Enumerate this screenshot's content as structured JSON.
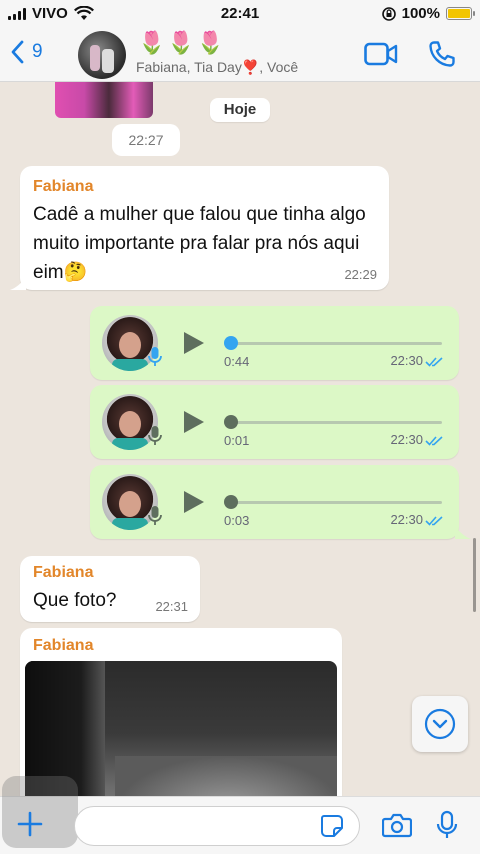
{
  "status_bar": {
    "carrier": "VIVO",
    "time": "22:41",
    "battery": "100%",
    "battery_level": 1.0
  },
  "header": {
    "back_count": "9",
    "group_name": "🌷🌷🌷",
    "participants": "Fabiana, Tia Day❣️, Você",
    "icons": [
      "chevron-left-icon",
      "video-icon",
      "phone-icon"
    ]
  },
  "chat": {
    "date_label": "Hoje",
    "prev_time": "22:27",
    "messages": [
      {
        "sender": "Fabiana",
        "text": "Cadê a mulher que falou que tinha algo muito importante pra falar pra nós aqui eim🤔",
        "time": "22:29"
      },
      {
        "type": "voice",
        "duration": "0:44",
        "time": "22:30",
        "progress": 0.0
      },
      {
        "type": "voice",
        "duration": "0:01",
        "time": "22:30",
        "progress": 0.0
      },
      {
        "type": "voice",
        "duration": "0:03",
        "time": "22:30",
        "progress": 0.0
      },
      {
        "sender": "Fabiana",
        "text": "Que foto?",
        "time": "22:31"
      },
      {
        "sender": "Fabiana",
        "type": "photo"
      }
    ]
  },
  "colors": {
    "accent": "#1a7be0",
    "outgoing_bubble": "#dcf8c6",
    "incoming_bubble": "#ffffff",
    "sender_name": "#e2862a",
    "read_ticks": "#34a4f0",
    "background": "#ece5dd"
  },
  "input": {
    "placeholder": "",
    "icons": [
      "plus-icon",
      "sticker-icon",
      "camera-icon",
      "mic-icon"
    ]
  }
}
